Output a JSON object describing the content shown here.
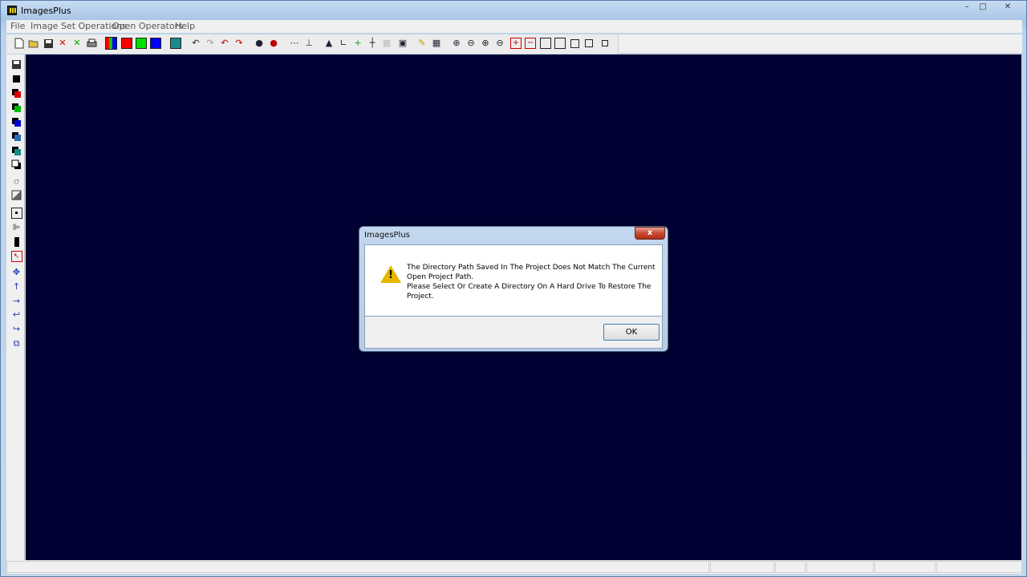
{
  "window": {
    "title": "ImagesPlus",
    "controls": {
      "minimize": "–",
      "maximize": "□",
      "close": "✕"
    }
  },
  "menu": [
    {
      "label": "File"
    },
    {
      "label": "Image Set Operations"
    },
    {
      "label": "Open Operators"
    },
    {
      "label": "Help"
    }
  ],
  "toolbar_icons": [
    "new-file-icon",
    "open-folder-icon",
    "save-icon",
    "close-icon",
    "cancel-icon",
    "print-icon",
    "rgb-channels-icon",
    "red-channel-icon",
    "green-channel-icon",
    "blue-channel-icon",
    "grid-icon",
    "undo-icon",
    "redo-icon",
    "undo-all-icon",
    "redo-all-icon",
    "mark-point-icon",
    "mark-point-red-icon",
    "dotted-line-icon",
    "network-icon",
    "histogram-icon",
    "graph-icon",
    "crosshair-add-icon",
    "crosshair-icon",
    "table-icon",
    "picture-icon",
    "pencil-icon",
    "grid-select-icon",
    "zoom-in-icon",
    "zoom-out-icon",
    "zoom-fit-icon",
    "zoom-reset-icon",
    "add-icon",
    "remove-icon",
    "frame-1-icon",
    "frame-2-icon",
    "frame-3-icon",
    "frame-4-icon",
    "frame-5-icon"
  ],
  "colors": {
    "canvas": "#000033",
    "red": "#ff0000",
    "green": "#00e000",
    "blue": "#0000ff",
    "warning": "#e6b600"
  },
  "dialog": {
    "title": "ImagesPlus",
    "message_line1": "The Directory Path Saved In The Project Does Not Match The Current",
    "message_line2": "Open Project Path.",
    "message_line3": "Please Select Or Create A Directory On A Hard Drive To Restore The",
    "message_line4": "Project.",
    "ok_label": "OK",
    "close_glyph": "x",
    "warning_glyph": "!"
  }
}
